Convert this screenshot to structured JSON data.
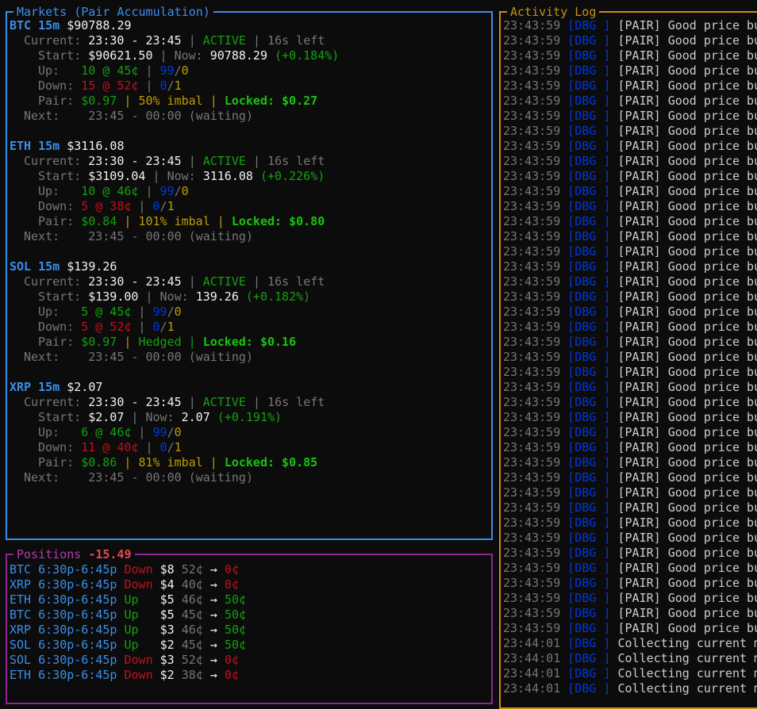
{
  "markets": {
    "title": "Markets (Pair Accumulation)",
    "items": [
      {
        "symbol": "BTC",
        "interval": "15m",
        "price": "$90788.29",
        "current_label": "Current:",
        "current_range": "23:30 - 23:45",
        "status": "ACTIVE",
        "time_left": "16s left",
        "start_label": "Start:",
        "start_value": "$90621.50",
        "now_label": "Now:",
        "now_value": "90788.29",
        "change": "(+0.184%)",
        "up_label": "Up:",
        "up_qty": "10 @ 45¢",
        "up_a": "99",
        "up_b": "0",
        "down_label": "Down:",
        "down_qty": "15 @ 52¢",
        "down_a": "0",
        "down_b": "1",
        "pair_label": "Pair:",
        "pair_value": "$0.97",
        "pair_state": "50% imbal",
        "locked": "Locked: $0.27",
        "next_label": "Next:",
        "next_range": "23:45 - 00:00 (waiting)"
      },
      {
        "symbol": "ETH",
        "interval": "15m",
        "price": "$3116.08",
        "current_label": "Current:",
        "current_range": "23:30 - 23:45",
        "status": "ACTIVE",
        "time_left": "16s left",
        "start_label": "Start:",
        "start_value": "$3109.04",
        "now_label": "Now:",
        "now_value": "3116.08",
        "change": "(+0.226%)",
        "up_label": "Up:",
        "up_qty": "10 @ 46¢",
        "up_a": "99",
        "up_b": "0",
        "down_label": "Down:",
        "down_qty": "5 @ 38¢",
        "down_a": "0",
        "down_b": "1",
        "pair_label": "Pair:",
        "pair_value": "$0.84",
        "pair_state": "101% imbal",
        "locked": "Locked: $0.80",
        "next_label": "Next:",
        "next_range": "23:45 - 00:00 (waiting)"
      },
      {
        "symbol": "SOL",
        "interval": "15m",
        "price": "$139.26",
        "current_label": "Current:",
        "current_range": "23:30 - 23:45",
        "status": "ACTIVE",
        "time_left": "16s left",
        "start_label": "Start:",
        "start_value": "$139.00",
        "now_label": "Now:",
        "now_value": "139.26",
        "change": "(+0.182%)",
        "up_label": "Up:",
        "up_qty": "5 @ 45¢",
        "up_a": "99",
        "up_b": "0",
        "down_label": "Down:",
        "down_qty": "5 @ 52¢",
        "down_a": "0",
        "down_b": "1",
        "pair_label": "Pair:",
        "pair_value": "$0.97",
        "pair_state": "Hedged",
        "locked": "Locked: $0.16",
        "next_label": "Next:",
        "next_range": "23:45 - 00:00 (waiting)"
      },
      {
        "symbol": "XRP",
        "interval": "15m",
        "price": "$2.07",
        "current_label": "Current:",
        "current_range": "23:30 - 23:45",
        "status": "ACTIVE",
        "time_left": "16s left",
        "start_label": "Start:",
        "start_value": "$2.07",
        "now_label": "Now:",
        "now_value": "2.07",
        "change": "(+0.191%)",
        "up_label": "Up:",
        "up_qty": "6 @ 46¢",
        "up_a": "99",
        "up_b": "0",
        "down_label": "Down:",
        "down_qty": "11 @ 40¢",
        "down_a": "0",
        "down_b": "1",
        "pair_label": "Pair:",
        "pair_value": "$0.86",
        "pair_state": "81% imbal",
        "locked": "Locked: $0.85",
        "next_label": "Next:",
        "next_range": "23:45 - 00:00 (waiting)"
      }
    ]
  },
  "positions": {
    "title": "Positions",
    "pnl": "-15.49",
    "rows": [
      {
        "asset": "BTC",
        "window": "6:30p-6:45p",
        "side": "Down",
        "amount": "$8",
        "entry": "52¢",
        "arrow": "→",
        "exit": "0¢"
      },
      {
        "asset": "XRP",
        "window": "6:30p-6:45p",
        "side": "Down",
        "amount": "$4",
        "entry": "40¢",
        "arrow": "→",
        "exit": "0¢"
      },
      {
        "asset": "ETH",
        "window": "6:30p-6:45p",
        "side": "Up",
        "amount": "$5",
        "entry": "46¢",
        "arrow": "→",
        "exit": "50¢"
      },
      {
        "asset": "BTC",
        "window": "6:30p-6:45p",
        "side": "Up",
        "amount": "$5",
        "entry": "45¢",
        "arrow": "→",
        "exit": "50¢"
      },
      {
        "asset": "XRP",
        "window": "6:30p-6:45p",
        "side": "Up",
        "amount": "$3",
        "entry": "46¢",
        "arrow": "→",
        "exit": "50¢"
      },
      {
        "asset": "SOL",
        "window": "6:30p-6:45p",
        "side": "Up",
        "amount": "$2",
        "entry": "45¢",
        "arrow": "→",
        "exit": "50¢"
      },
      {
        "asset": "SOL",
        "window": "6:30p-6:45p",
        "side": "Down",
        "amount": "$3",
        "entry": "52¢",
        "arrow": "→",
        "exit": "0¢"
      },
      {
        "asset": "ETH",
        "window": "6:30p-6:45p",
        "side": "Down",
        "amount": "$2",
        "entry": "38¢",
        "arrow": "→",
        "exit": "0¢"
      }
    ]
  },
  "activity": {
    "title": "Activity Log",
    "entries": [
      {
        "time": "23:43:59",
        "level": "[DBG ]",
        "msg": "[PAIR] Good price bu"
      },
      {
        "time": "23:43:59",
        "level": "[DBG ]",
        "msg": "[PAIR] Good price bu"
      },
      {
        "time": "23:43:59",
        "level": "[DBG ]",
        "msg": "[PAIR] Good price bu"
      },
      {
        "time": "23:43:59",
        "level": "[DBG ]",
        "msg": "[PAIR] Good price bu"
      },
      {
        "time": "23:43:59",
        "level": "[DBG ]",
        "msg": "[PAIR] Good price bu"
      },
      {
        "time": "23:43:59",
        "level": "[DBG ]",
        "msg": "[PAIR] Good price bu"
      },
      {
        "time": "23:43:59",
        "level": "[DBG ]",
        "msg": "[PAIR] Good price bu"
      },
      {
        "time": "23:43:59",
        "level": "[DBG ]",
        "msg": "[PAIR] Good price bu"
      },
      {
        "time": "23:43:59",
        "level": "[DBG ]",
        "msg": "[PAIR] Good price bu"
      },
      {
        "time": "23:43:59",
        "level": "[DBG ]",
        "msg": "[PAIR] Good price bu"
      },
      {
        "time": "23:43:59",
        "level": "[DBG ]",
        "msg": "[PAIR] Good price bu"
      },
      {
        "time": "23:43:59",
        "level": "[DBG ]",
        "msg": "[PAIR] Good price bu"
      },
      {
        "time": "23:43:59",
        "level": "[DBG ]",
        "msg": "[PAIR] Good price bu"
      },
      {
        "time": "23:43:59",
        "level": "[DBG ]",
        "msg": "[PAIR] Good price bu"
      },
      {
        "time": "23:43:59",
        "level": "[DBG ]",
        "msg": "[PAIR] Good price bu"
      },
      {
        "time": "23:43:59",
        "level": "[DBG ]",
        "msg": "[PAIR] Good price bu"
      },
      {
        "time": "23:43:59",
        "level": "[DBG ]",
        "msg": "[PAIR] Good price bu"
      },
      {
        "time": "23:43:59",
        "level": "[DBG ]",
        "msg": "[PAIR] Good price bu"
      },
      {
        "time": "23:43:59",
        "level": "[DBG ]",
        "msg": "[PAIR] Good price bu"
      },
      {
        "time": "23:43:59",
        "level": "[DBG ]",
        "msg": "[PAIR] Good price bu"
      },
      {
        "time": "23:43:59",
        "level": "[DBG ]",
        "msg": "[PAIR] Good price bu"
      },
      {
        "time": "23:43:59",
        "level": "[DBG ]",
        "msg": "[PAIR] Good price bu"
      },
      {
        "time": "23:43:59",
        "level": "[DBG ]",
        "msg": "[PAIR] Good price bu"
      },
      {
        "time": "23:43:59",
        "level": "[DBG ]",
        "msg": "[PAIR] Good price bu"
      },
      {
        "time": "23:43:59",
        "level": "[DBG ]",
        "msg": "[PAIR] Good price bu"
      },
      {
        "time": "23:43:59",
        "level": "[DBG ]",
        "msg": "[PAIR] Good price bu"
      },
      {
        "time": "23:43:59",
        "level": "[DBG ]",
        "msg": "[PAIR] Good price bu"
      },
      {
        "time": "23:43:59",
        "level": "[DBG ]",
        "msg": "[PAIR] Good price bu"
      },
      {
        "time": "23:43:59",
        "level": "[DBG ]",
        "msg": "[PAIR] Good price bu"
      },
      {
        "time": "23:43:59",
        "level": "[DBG ]",
        "msg": "[PAIR] Good price bu"
      },
      {
        "time": "23:43:59",
        "level": "[DBG ]",
        "msg": "[PAIR] Good price bu"
      },
      {
        "time": "23:43:59",
        "level": "[DBG ]",
        "msg": "[PAIR] Good price bu"
      },
      {
        "time": "23:43:59",
        "level": "[DBG ]",
        "msg": "[PAIR] Good price bu"
      },
      {
        "time": "23:43:59",
        "level": "[DBG ]",
        "msg": "[PAIR] Good price bu"
      },
      {
        "time": "23:43:59",
        "level": "[DBG ]",
        "msg": "[PAIR] Good price bu"
      },
      {
        "time": "23:43:59",
        "level": "[DBG ]",
        "msg": "[PAIR] Good price bu"
      },
      {
        "time": "23:43:59",
        "level": "[DBG ]",
        "msg": "[PAIR] Good price bu"
      },
      {
        "time": "23:43:59",
        "level": "[DBG ]",
        "msg": "[PAIR] Good price bu"
      },
      {
        "time": "23:43:59",
        "level": "[DBG ]",
        "msg": "[PAIR] Good price bu"
      },
      {
        "time": "23:43:59",
        "level": "[DBG ]",
        "msg": "[PAIR] Good price bu"
      },
      {
        "time": "23:43:59",
        "level": "[DBG ]",
        "msg": "[PAIR] Good price bu"
      },
      {
        "time": "23:44:01",
        "level": "[DBG ]",
        "msg": "Collecting current m"
      },
      {
        "time": "23:44:01",
        "level": "[DBG ]",
        "msg": "Collecting current m"
      },
      {
        "time": "23:44:01",
        "level": "[DBG ]",
        "msg": "Collecting current m"
      },
      {
        "time": "23:44:01",
        "level": "[DBG ]",
        "msg": "Collecting current m"
      }
    ]
  },
  "colors": {
    "markets_border": "#3b8eea",
    "positions_border": "#8f2594",
    "activity_border": "#c59010",
    "background": "#0c0c0c"
  }
}
